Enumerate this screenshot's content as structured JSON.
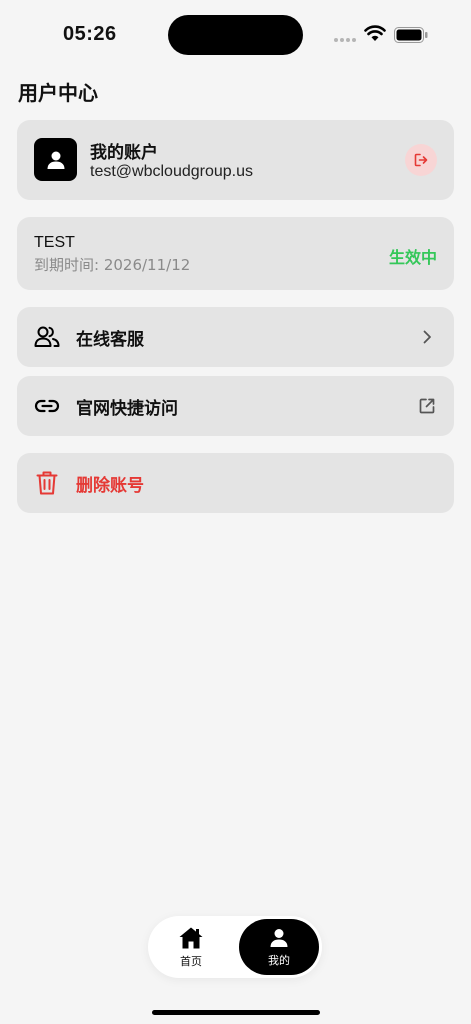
{
  "status_bar": {
    "time": "05:26"
  },
  "page": {
    "title": "用户中心"
  },
  "account": {
    "label": "我的账户",
    "email": "test@wbcloudgroup.us",
    "avatar_icon": "person-icon",
    "logout_icon": "logout-icon"
  },
  "plan": {
    "name": "TEST",
    "expiry": "到期时间: 2026/11/12",
    "status": "生效中"
  },
  "menu": {
    "support": {
      "label": "在线客服",
      "icon": "users-icon",
      "trail_icon": "chevron-right-icon"
    },
    "website": {
      "label": "官网快捷访问",
      "icon": "link-icon",
      "trail_icon": "external-link-icon"
    },
    "delete": {
      "label": "删除账号",
      "icon": "trash-icon"
    }
  },
  "tabs": {
    "home": {
      "label": "首页",
      "icon": "home-icon"
    },
    "mine": {
      "label": "我的",
      "icon": "person-icon",
      "active": true
    }
  },
  "colors": {
    "accent": "#000000",
    "danger": "#e53935",
    "success": "#34c759",
    "card_bg": "#e4e4e4",
    "page_bg": "#f5f5f5"
  }
}
